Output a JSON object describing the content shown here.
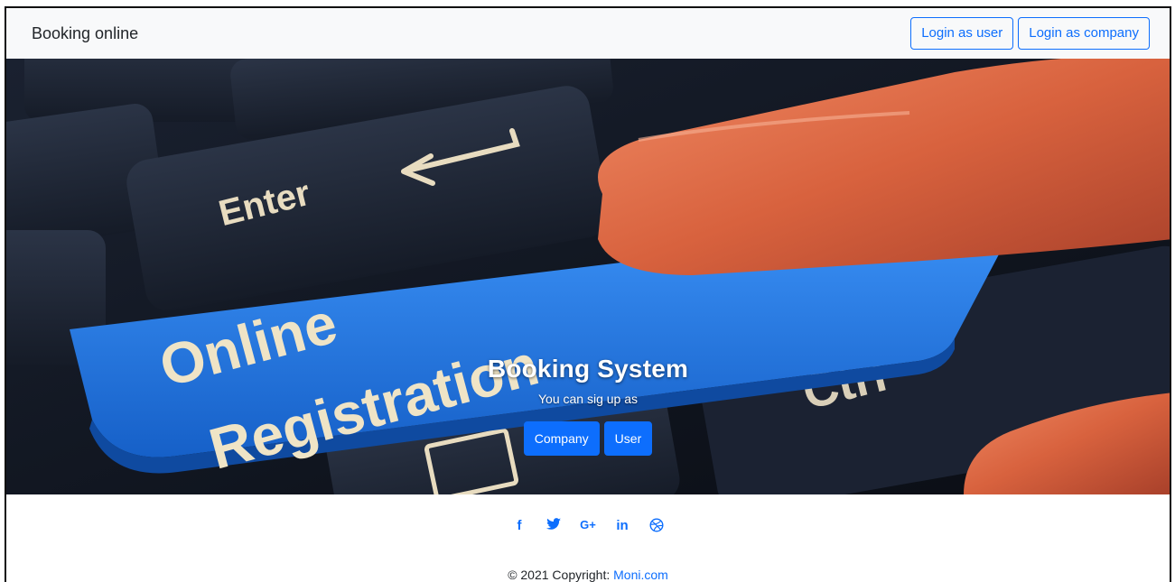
{
  "navbar": {
    "brand": "Booking online",
    "login_user_label": "Login as user",
    "login_company_label": "Login as company"
  },
  "hero": {
    "key_text_line1": "Online",
    "key_text_line2": "Registration",
    "enter_key_label": "Enter",
    "ctrl_key_label": "Ctrl",
    "title": "Booking System",
    "subtitle": "You can sig up as",
    "company_button": "Company",
    "user_button": "User"
  },
  "footer": {
    "social_icons": [
      "facebook-icon",
      "twitter-icon",
      "google-plus-icon",
      "linkedin-icon",
      "dribbble-icon"
    ],
    "facebook_glyph": "f",
    "googleplus_glyph": "G+",
    "linkedin_glyph": "in",
    "copyright_prefix": "© 2021 Copyright: ",
    "copyright_link": "Moni.com"
  },
  "colors": {
    "primary": "#0d6efd",
    "navbar_bg": "#f8f9fa",
    "key_blue": "#1e78e8",
    "key_dark": "#1c2433"
  }
}
